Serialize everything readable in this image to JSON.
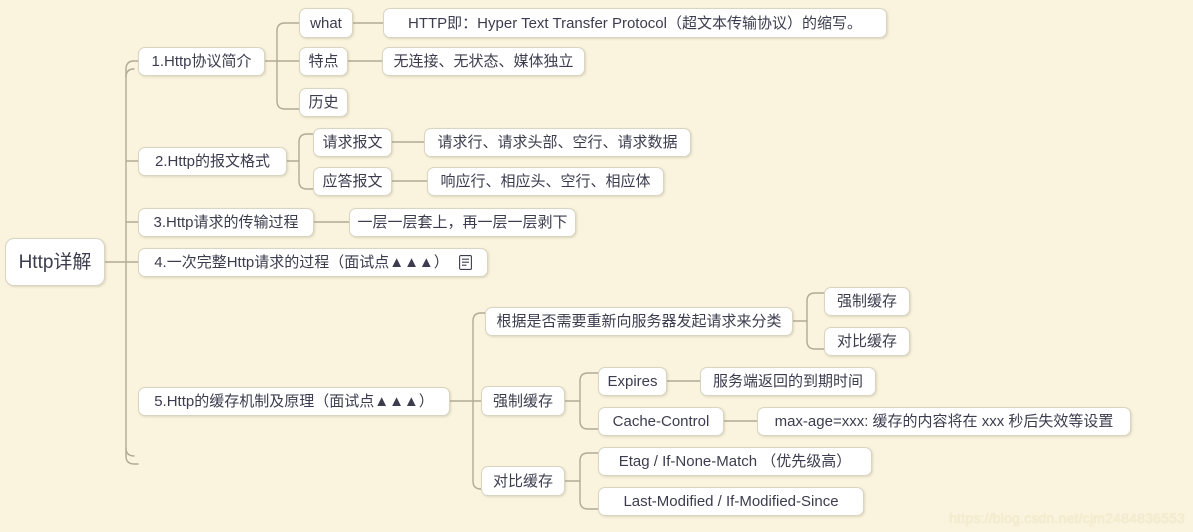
{
  "theme": {
    "background_color": "#faf4de",
    "node_fill": "#ffffff",
    "node_border": "#d9d5c3",
    "link_color": "#b0aa96",
    "text_color": "#3c3c4e"
  },
  "watermark": {
    "text": "https://blog.csdn.net/cjm2484836553"
  },
  "mindmap": {
    "root": {
      "label": "Http详解"
    },
    "branches": [
      {
        "label": "1.Http协议简介",
        "children": [
          {
            "label": "what",
            "children": [
              {
                "label": "HTTP即：Hyper Text Transfer Protocol（超文本传输协议）的缩写。"
              }
            ]
          },
          {
            "label": "特点",
            "children": [
              {
                "label": "无连接、无状态、媒体独立"
              }
            ]
          },
          {
            "label": "历史",
            "children": []
          }
        ]
      },
      {
        "label": "2.Http的报文格式",
        "children": [
          {
            "label": "请求报文",
            "children": [
              {
                "label": "请求行、请求头部、空行、请求数据"
              }
            ]
          },
          {
            "label": "应答报文",
            "children": [
              {
                "label": "响应行、相应头、空行、相应体"
              }
            ]
          }
        ]
      },
      {
        "label": "3.Http请求的传输过程",
        "children": [
          {
            "label": "一层一层套上，再一层一层剥下",
            "children": []
          }
        ]
      },
      {
        "label": "4.一次完整Http请求的过程（面试点▲▲▲）",
        "icon": "note-icon",
        "children": []
      },
      {
        "label": "5.Http的缓存机制及原理（面试点▲▲▲）",
        "children": [
          {
            "label": "根据是否需要重新向服务器发起请求来分类",
            "children": [
              {
                "label": "强制缓存"
              },
              {
                "label": "对比缓存"
              }
            ]
          },
          {
            "label": "强制缓存",
            "children": [
              {
                "label": "Expires",
                "children": [
                  {
                    "label": "服务端返回的到期时间"
                  }
                ]
              },
              {
                "label": "Cache-Control",
                "children": [
                  {
                    "label": "max-age=xxx: 缓存的内容将在 xxx 秒后失效等设置"
                  }
                ]
              }
            ]
          },
          {
            "label": "对比缓存",
            "children": [
              {
                "label": "Etag / If-None-Match （优先级高）"
              },
              {
                "label": "Last-Modified / If-Modified-Since"
              }
            ]
          }
        ]
      }
    ]
  }
}
